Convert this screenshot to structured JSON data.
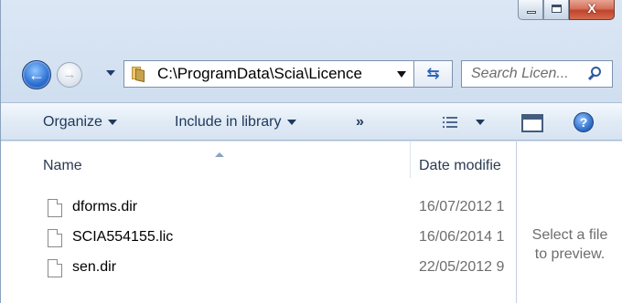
{
  "window": {
    "caption_buttons": {
      "minimize": "minimize",
      "maximize": "maximize",
      "close": "X"
    }
  },
  "nav": {
    "back_icon": "←",
    "forward_icon": "→",
    "address": "C:\\ProgramData\\Scia\\Licence",
    "refresh_icon": "⇆",
    "search_placeholder": "Search Licen..."
  },
  "toolbar": {
    "organize": "Organize",
    "include": "Include in library",
    "more": "»",
    "help": "?"
  },
  "columns": {
    "name": "Name",
    "date": "Date modifie"
  },
  "files": [
    {
      "name": "dforms.dir",
      "date": "16/07/2012 1"
    },
    {
      "name": "SCIA554155.lic",
      "date": "16/06/2014 1"
    },
    {
      "name": "sen.dir",
      "date": "22/05/2012 9"
    }
  ],
  "preview": {
    "line1": "Select a file",
    "line2": "to preview."
  },
  "colors": {
    "accent": "#2a6dd0",
    "command_text": "#1e395b",
    "close_red": "#c1432c"
  }
}
